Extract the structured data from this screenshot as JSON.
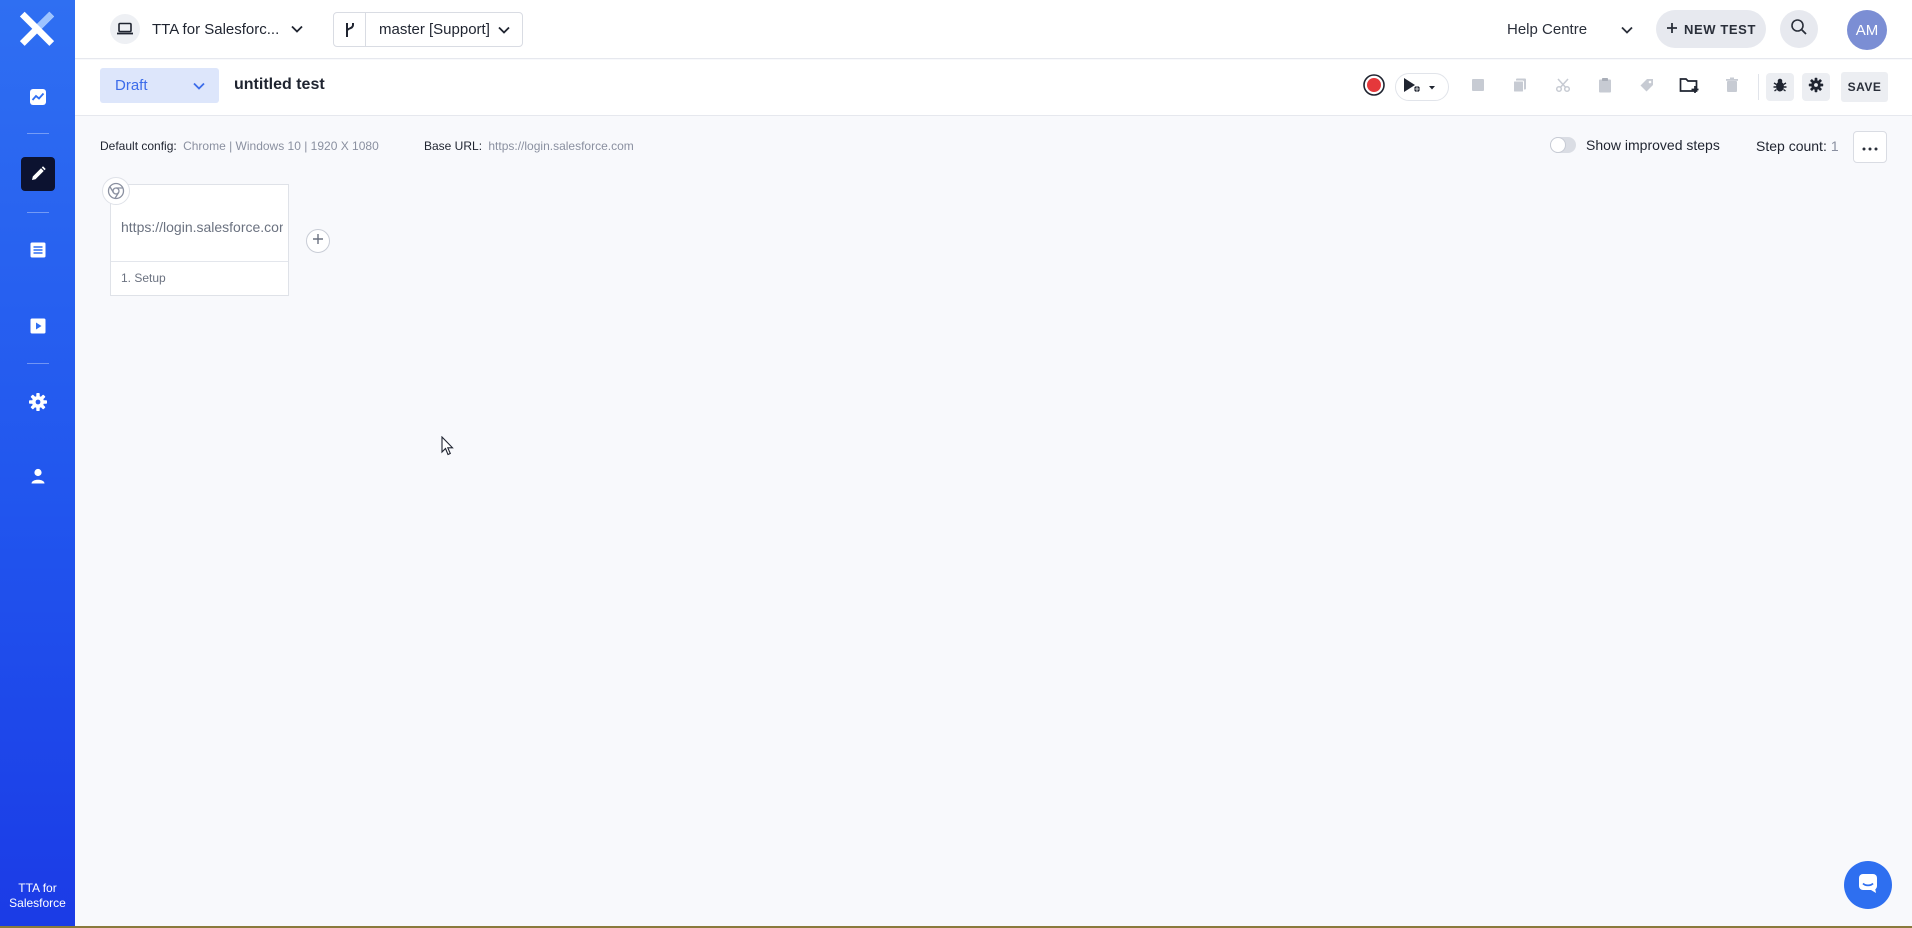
{
  "sidebar": {
    "label": "TTA for Salesforce",
    "items": [
      {
        "name": "dashboard",
        "icon": "chart-icon"
      },
      {
        "name": "editor",
        "icon": "pencil-icon",
        "active": true
      },
      {
        "name": "tests",
        "icon": "list-icon"
      },
      {
        "name": "runs",
        "icon": "play-icon"
      },
      {
        "name": "settings",
        "icon": "gear-icon"
      },
      {
        "name": "account",
        "icon": "user-icon"
      }
    ]
  },
  "header": {
    "project": "TTA for Salesforc...",
    "branch": "master [Support]",
    "help": "Help Centre",
    "new_test": "NEW TEST",
    "avatar": "AM"
  },
  "toolbar": {
    "status": "Draft",
    "title": "untitled test",
    "save": "SAVE"
  },
  "info": {
    "config_label": "Default config:",
    "config_value": "Chrome | Windows 10 | 1920 X 1080",
    "base_label": "Base URL:",
    "base_value": "https://login.salesforce.com",
    "toggle_label": "Show improved steps",
    "toggle_on": false,
    "stepcount_label": "Step count:",
    "stepcount_value": "1"
  },
  "steps": [
    {
      "url": "https://login.salesforce.com",
      "label": "1. Setup"
    }
  ],
  "colors": {
    "accent": "#2f6ff2",
    "record": "#e5383b",
    "draft_bg": "#dde6fb",
    "draft_text": "#3c6cea"
  }
}
